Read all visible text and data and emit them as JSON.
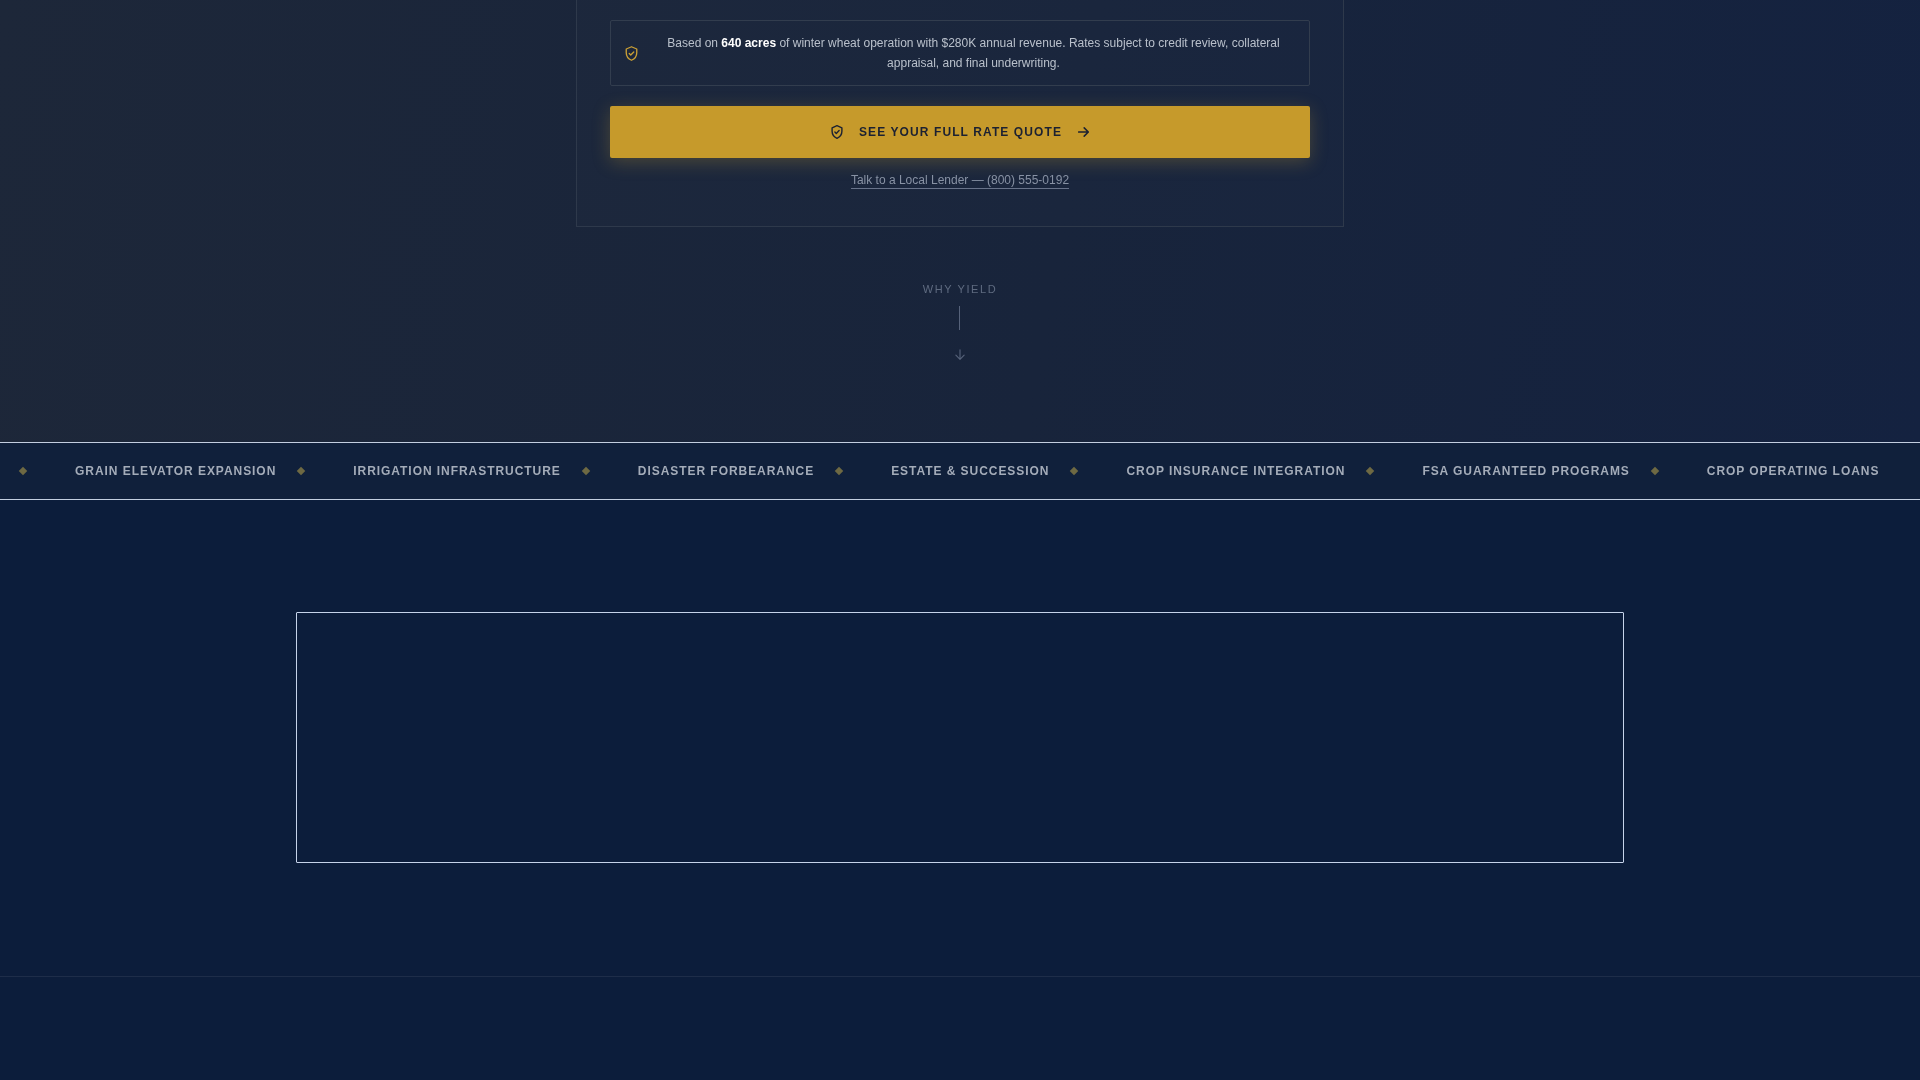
{
  "rate_card": {
    "note": "Based on **640 acres** of winter wheat operation with $280K annual revenue. Rates subject to credit review, collateral appraisal, and final underwriting.",
    "cta_button": {
      "label": "SEE YOUR FULL RATE QUOTE"
    },
    "contact_link": "Talk to a Local Lender — (800) 555-0192"
  },
  "section_hint": {
    "label": "WHY YIELD"
  },
  "ticker": {
    "items": [
      "GRAIN ELEVATOR EXPANSION",
      "IRRIGATION INFRASTRUCTURE",
      "DISASTER FORBEARANCE",
      "ESTATE & SUCCESSION",
      "CROP INSURANCE INTEGRATION",
      "FSA GUARANTEED PROGRAMS",
      "CROP OPERATING LOANS"
    ]
  }
}
